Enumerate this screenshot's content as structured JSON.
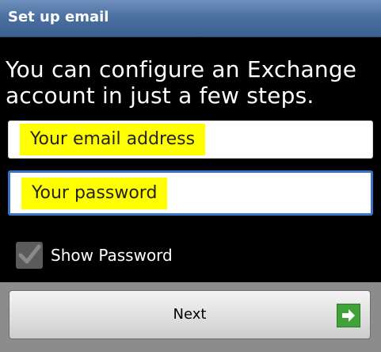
{
  "title_bar": {
    "title": "Set up email"
  },
  "intro": {
    "text": "You can configure an Exchange account in just a few steps."
  },
  "email_field": {
    "placeholder": "Your email address",
    "value": ""
  },
  "password_field": {
    "placeholder": "Your password",
    "value": ""
  },
  "show_password": {
    "label": "Show Password",
    "checked": true
  },
  "next_button": {
    "label": "Next",
    "icon": "arrow-right-icon"
  },
  "colors": {
    "title_bar": "#4a6fa0",
    "highlight": "#ffff00",
    "focus_border": "#3a74c8",
    "next_icon": "#3fa33a"
  }
}
